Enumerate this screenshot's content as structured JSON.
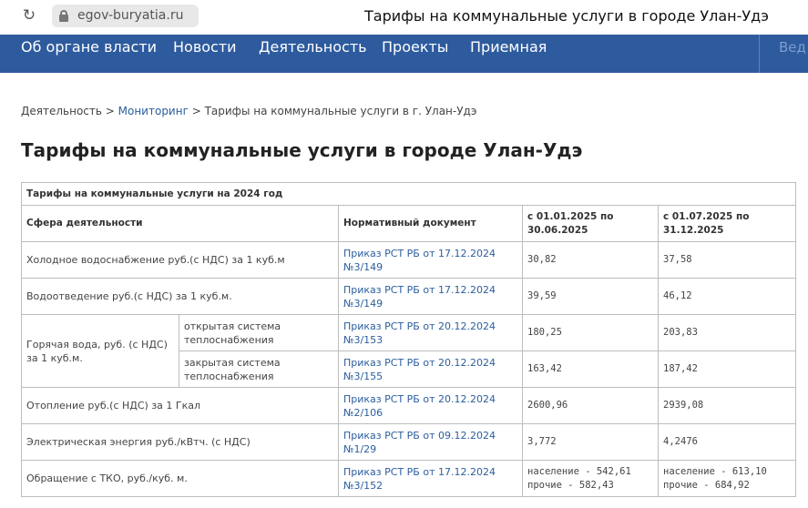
{
  "browser": {
    "reload_icon": "reload-icon",
    "url": "egov-buryatia.ru",
    "tab_title": "Тарифы на коммунальные услуги в городе Улан-Удэ"
  },
  "nav": {
    "items": [
      "Об органе власти",
      "Новости",
      "Деятельность",
      "Проекты",
      "Приемная"
    ],
    "cut_item": "Вед"
  },
  "breadcrumb": {
    "home": "Деятельность",
    "sep1": " > ",
    "link": "Мониторинг",
    "sep2": " > ",
    "current": "Тарифы на коммунальные услуги в г. Улан-Удэ"
  },
  "page_title": "Тарифы на коммунальные услуги в городе Улан-Удэ",
  "table": {
    "caption": "Тарифы на коммунальные услуги на 2024 год",
    "headers": {
      "sphere": "Сфера деятельности",
      "document": "Нормативный документ",
      "period1": "с 01.01.2025 по 30.06.2025",
      "period2": "с 01.07.2025 по 31.12.2025"
    },
    "rows": [
      {
        "sphere": "Холодное водоснабжение руб.(с НДС) за 1 куб.м",
        "document": "Приказ РСТ РБ от 17.12.2024 №3/149",
        "p1": "30,82",
        "p2": "37,58"
      },
      {
        "sphere": "Водоотведение руб.(с НДС) за 1 куб.м.",
        "document": "Приказ РСТ РБ от 17.12.2024 №3/149",
        "p1": "39,59",
        "p2": "46,12"
      },
      {
        "sphere": "Горячая вода, руб. (с НДС) за 1 куб.м.",
        "sub": "открытая система теплоснабжения",
        "document": "Приказ РСТ РБ от 20.12.2024 №3/153",
        "p1": "180,25",
        "p2": "203,83"
      },
      {
        "sub": "закрытая система теплоснабжения",
        "document": "Приказ РСТ РБ от 20.12.2024 №3/155",
        "p1": "163,42",
        "p2": "187,42"
      },
      {
        "sphere": "Отопление руб.(с НДС) за 1 Гкал",
        "document": "Приказ РСТ РБ от 20.12.2024 №2/106",
        "p1": "2600,96",
        "p2": "2939,08"
      },
      {
        "sphere": "Электрическая энергия руб./кВтч. (с НДС)",
        "document": "Приказ РСТ РБ от 09.12.2024 №1/29",
        "p1": "3,772",
        "p2": "4,2476"
      },
      {
        "sphere": "Обращение с ТКО, руб./куб. м.",
        "document": "Приказ РСТ РБ от 17.12.2024 №3/152",
        "p1_a": "население - 542,61",
        "p1_b": "прочие - 582,43",
        "p2_a": "население - 613,10",
        "p2_b": "прочие - 684,92"
      }
    ]
  },
  "colors": {
    "nav_bg": "#2e5b9e",
    "link": "#2b5e9e",
    "border": "#bdbdbd"
  }
}
